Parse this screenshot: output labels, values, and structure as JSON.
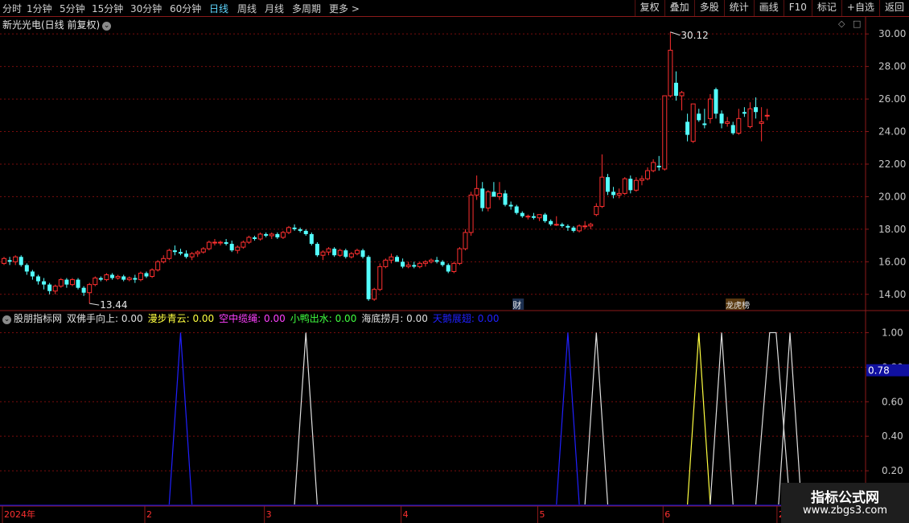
{
  "toolbar": {
    "periods": [
      "分时",
      "1分钟",
      "5分钟",
      "15分钟",
      "30分钟",
      "60分钟",
      "日线",
      "周线",
      "月线",
      "多周期",
      "更多 >"
    ],
    "active_period": "日线",
    "buttons": [
      "复权",
      "叠加",
      "多股",
      "统计",
      "画线",
      "F10",
      "标记",
      "+自选",
      "返回"
    ]
  },
  "stock": {
    "title": "新光光电(日线 前复权)"
  },
  "indicator": {
    "name": "股朋指标网",
    "items": [
      {
        "label": "双佛手向上: 0.00",
        "color": "#e0e0e0"
      },
      {
        "label": "漫步青云: 0.00",
        "color": "#ffff40"
      },
      {
        "label": "空中缆绳: 0.00",
        "color": "#ff40ff"
      },
      {
        "label": "小鸭出水: 0.00",
        "color": "#40ff40"
      },
      {
        "label": "海底捞月: 0.00",
        "color": "#e0e0e0"
      },
      {
        "label": "天鹅展翅: 0.00",
        "color": "#2020ff"
      }
    ],
    "cursor_value": "0.78"
  },
  "colors": {
    "up": "#ff3030",
    "down": "#54ffff",
    "grid": "#7a0d0d",
    "border": "#8b1a1a",
    "axis_text": "#c8c8c8"
  },
  "chart_data": [
    {
      "type": "candlestick",
      "ylim": [
        13.0,
        30.8
      ],
      "ylabel_ticks": [
        "30.00",
        "28.00",
        "26.00",
        "24.00",
        "22.00",
        "20.00",
        "18.00",
        "16.00",
        "14.00"
      ],
      "high_label": "30.12",
      "low_label": "13.44",
      "markers": [
        "财",
        "龙虎榜"
      ],
      "ohlc": [
        [
          15.9,
          16.3,
          15.8,
          16.2
        ],
        [
          16.1,
          16.3,
          15.8,
          16.0
        ],
        [
          16.0,
          16.4,
          15.8,
          16.3
        ],
        [
          16.3,
          16.4,
          15.7,
          15.8
        ],
        [
          15.8,
          15.9,
          15.2,
          15.4
        ],
        [
          15.4,
          15.5,
          14.9,
          15.1
        ],
        [
          15.1,
          15.2,
          14.6,
          14.8
        ],
        [
          14.8,
          15.0,
          14.3,
          14.6
        ],
        [
          14.6,
          14.7,
          14.0,
          14.2
        ],
        [
          14.2,
          14.6,
          14.0,
          14.5
        ],
        [
          14.5,
          15.0,
          14.4,
          14.9
        ],
        [
          14.9,
          15.0,
          14.4,
          14.6
        ],
        [
          14.6,
          15.0,
          14.5,
          14.9
        ],
        [
          14.9,
          15.0,
          14.3,
          14.4
        ],
        [
          14.4,
          14.5,
          13.9,
          14.1
        ],
        [
          14.1,
          14.7,
          13.44,
          14.6
        ],
        [
          14.6,
          15.1,
          14.5,
          15.0
        ],
        [
          15.0,
          15.1,
          14.8,
          14.9
        ],
        [
          14.9,
          15.3,
          14.8,
          15.2
        ],
        [
          15.2,
          15.3,
          14.9,
          15.0
        ],
        [
          15.0,
          15.2,
          14.9,
          15.1
        ],
        [
          15.1,
          15.2,
          14.8,
          14.9
        ],
        [
          14.9,
          15.1,
          14.8,
          15.0
        ],
        [
          15.0,
          15.2,
          14.7,
          14.9
        ],
        [
          14.9,
          15.4,
          14.8,
          15.3
        ],
        [
          15.3,
          15.4,
          15.0,
          15.1
        ],
        [
          15.1,
          15.6,
          15.0,
          15.5
        ],
        [
          15.5,
          16.1,
          15.4,
          16.0
        ],
        [
          16.0,
          16.4,
          15.9,
          16.2
        ],
        [
          16.2,
          16.8,
          16.1,
          16.7
        ],
        [
          16.7,
          17.0,
          16.4,
          16.6
        ],
        [
          16.6,
          16.8,
          16.4,
          16.5
        ],
        [
          16.5,
          16.7,
          16.2,
          16.3
        ],
        [
          16.3,
          16.6,
          16.1,
          16.5
        ],
        [
          16.5,
          16.7,
          16.3,
          16.6
        ],
        [
          16.6,
          16.9,
          16.5,
          16.8
        ],
        [
          16.8,
          17.3,
          16.7,
          17.2
        ],
        [
          17.2,
          17.4,
          17.0,
          17.2
        ],
        [
          17.2,
          17.3,
          17.0,
          17.2
        ],
        [
          17.2,
          17.4,
          17.0,
          17.1
        ],
        [
          17.1,
          17.3,
          16.6,
          16.7
        ],
        [
          16.7,
          17.0,
          16.5,
          16.9
        ],
        [
          16.9,
          17.3,
          16.8,
          17.2
        ],
        [
          17.2,
          17.6,
          17.1,
          17.5
        ],
        [
          17.5,
          17.6,
          17.3,
          17.4
        ],
        [
          17.4,
          17.8,
          17.3,
          17.7
        ],
        [
          17.7,
          17.8,
          17.5,
          17.6
        ],
        [
          17.6,
          17.8,
          17.4,
          17.7
        ],
        [
          17.7,
          17.8,
          17.4,
          17.5
        ],
        [
          17.5,
          17.9,
          17.4,
          17.8
        ],
        [
          17.8,
          18.2,
          17.7,
          18.1
        ],
        [
          18.1,
          18.3,
          17.9,
          18.0
        ],
        [
          18.0,
          18.1,
          17.8,
          17.9
        ],
        [
          17.9,
          18.0,
          17.6,
          17.7
        ],
        [
          17.7,
          17.8,
          17.0,
          17.1
        ],
        [
          17.1,
          17.2,
          16.3,
          16.4
        ],
        [
          16.4,
          16.7,
          16.1,
          16.6
        ],
        [
          16.6,
          16.9,
          16.4,
          16.8
        ],
        [
          16.8,
          16.9,
          16.3,
          16.4
        ],
        [
          16.4,
          16.8,
          16.3,
          16.7
        ],
        [
          16.7,
          16.8,
          16.2,
          16.3
        ],
        [
          16.3,
          16.6,
          16.2,
          16.5
        ],
        [
          16.5,
          16.8,
          16.4,
          16.7
        ],
        [
          16.7,
          16.8,
          16.2,
          16.3
        ],
        [
          16.3,
          16.4,
          13.6,
          13.7
        ],
        [
          13.7,
          14.4,
          13.6,
          14.3
        ],
        [
          14.3,
          15.9,
          14.2,
          15.7
        ],
        [
          15.7,
          16.2,
          15.6,
          16.1
        ],
        [
          16.1,
          16.5,
          15.9,
          16.3
        ],
        [
          16.3,
          16.4,
          16.0,
          16.0
        ],
        [
          16.0,
          16.2,
          15.6,
          15.7
        ],
        [
          15.7,
          16.0,
          15.6,
          15.8
        ],
        [
          15.8,
          16.0,
          15.6,
          15.7
        ],
        [
          15.7,
          16.0,
          15.6,
          15.9
        ],
        [
          15.9,
          16.1,
          15.7,
          16.0
        ],
        [
          16.0,
          16.2,
          15.9,
          16.1
        ],
        [
          16.1,
          16.3,
          15.9,
          16.0
        ],
        [
          16.0,
          16.1,
          15.7,
          15.8
        ],
        [
          15.8,
          15.9,
          15.3,
          15.4
        ],
        [
          15.4,
          16.0,
          15.3,
          15.9
        ],
        [
          15.9,
          16.9,
          15.8,
          16.8
        ],
        [
          16.8,
          18.0,
          16.7,
          17.8
        ],
        [
          17.8,
          20.3,
          17.6,
          20.1
        ],
        [
          20.1,
          21.3,
          19.8,
          20.5
        ],
        [
          20.5,
          20.9,
          19.1,
          19.3
        ],
        [
          19.3,
          20.4,
          19.1,
          20.3
        ],
        [
          20.3,
          20.9,
          20.0,
          20.0
        ],
        [
          20.0,
          20.9,
          19.8,
          20.2
        ],
        [
          20.2,
          20.4,
          19.4,
          19.5
        ],
        [
          19.5,
          19.7,
          19.2,
          19.4
        ],
        [
          19.4,
          19.5,
          18.9,
          19.0
        ],
        [
          19.0,
          19.1,
          18.7,
          18.8
        ],
        [
          18.8,
          18.9,
          18.6,
          18.8
        ],
        [
          18.8,
          19.0,
          18.6,
          18.7
        ],
        [
          18.7,
          18.9,
          18.5,
          18.9
        ],
        [
          18.9,
          19.0,
          18.4,
          18.5
        ],
        [
          18.5,
          18.6,
          18.2,
          18.3
        ],
        [
          18.3,
          18.8,
          18.2,
          18.3
        ],
        [
          18.3,
          18.4,
          18.1,
          18.2
        ],
        [
          18.2,
          18.3,
          17.9,
          18.1
        ],
        [
          18.1,
          18.2,
          17.8,
          17.9
        ],
        [
          17.9,
          18.3,
          17.8,
          18.2
        ],
        [
          18.2,
          18.5,
          18.0,
          18.2
        ],
        [
          18.2,
          18.4,
          18.0,
          18.3
        ],
        [
          18.9,
          19.6,
          18.8,
          19.4
        ],
        [
          19.4,
          22.6,
          19.3,
          21.2
        ],
        [
          21.2,
          21.4,
          20.1,
          20.3
        ],
        [
          20.3,
          20.6,
          19.9,
          20.1
        ],
        [
          20.1,
          20.5,
          19.9,
          20.2
        ],
        [
          20.2,
          21.2,
          20.1,
          21.1
        ],
        [
          21.1,
          21.3,
          20.2,
          20.4
        ],
        [
          20.4,
          21.2,
          20.3,
          21.0
        ],
        [
          21.0,
          21.3,
          20.7,
          21.1
        ],
        [
          21.1,
          21.8,
          21.0,
          21.6
        ],
        [
          21.6,
          22.3,
          21.5,
          22.1
        ],
        [
          21.9,
          22.5,
          21.6,
          21.8
        ],
        [
          21.7,
          26.2,
          21.6,
          26.2
        ],
        [
          26.2,
          30.12,
          26.1,
          29.0
        ],
        [
          27.0,
          27.7,
          25.9,
          26.2
        ],
        [
          26.2,
          26.5,
          25.3,
          26.4
        ],
        [
          24.6,
          25.1,
          23.4,
          23.8
        ],
        [
          23.4,
          25.6,
          23.3,
          25.7
        ],
        [
          25.1,
          25.4,
          24.6,
          24.7
        ],
        [
          24.5,
          25.4,
          24.2,
          24.4
        ],
        [
          24.8,
          26.3,
          24.5,
          26.0
        ],
        [
          26.6,
          26.7,
          24.8,
          25.1
        ],
        [
          25.1,
          25.3,
          24.2,
          24.5
        ],
        [
          24.5,
          24.9,
          24.3,
          24.6
        ],
        [
          24.4,
          24.6,
          23.8,
          23.9
        ],
        [
          23.9,
          25.4,
          23.8,
          24.8
        ],
        [
          25.2,
          25.5,
          24.9,
          25.1
        ],
        [
          24.3,
          25.8,
          24.2,
          25.4
        ],
        [
          25.5,
          26.1,
          24.8,
          25.2
        ],
        [
          24.5,
          25.5,
          23.4,
          24.6
        ],
        [
          25.0,
          25.4,
          24.7,
          25.0
        ]
      ]
    },
    {
      "type": "line",
      "ylim": [
        0,
        1.1
      ],
      "ylabel_ticks": [
        "1.00",
        "0.80",
        "0.60",
        "0.40",
        "0.20"
      ],
      "x_labels": [
        "2024年",
        "2",
        "3",
        "4",
        "5",
        "6",
        "20"
      ],
      "series": [
        {
          "name": "双佛手向上",
          "color": "#e0e0e0",
          "values": []
        },
        {
          "name": "漫步青云",
          "color": "#ffff40",
          "values": []
        },
        {
          "name": "空中缆绳",
          "color": "#ff40ff",
          "values": []
        },
        {
          "name": "小鸭出水",
          "color": "#40ff40",
          "values": []
        },
        {
          "name": "海底捞月",
          "color": "#e0e0e0",
          "values": []
        },
        {
          "name": "天鹅展翅",
          "color": "#2020ff",
          "values": []
        }
      ],
      "spikes": [
        {
          "series": "天鹅展翅",
          "center_day": 31,
          "width": 2
        },
        {
          "series": "海底捞月",
          "center_day": 53,
          "width": 2
        },
        {
          "series": "天鹅展翅",
          "center_day": 99,
          "width": 2
        },
        {
          "series": "海底捞月",
          "center_day": 104,
          "width": 2
        },
        {
          "series": "漫步青云",
          "center_day": 122,
          "width": 2
        },
        {
          "series": "海底捞月",
          "center_day": 126,
          "width": 2
        },
        {
          "series": "海底捞月",
          "center_day": 135,
          "width": 3
        },
        {
          "series": "海底捞月",
          "center_day": 138,
          "width": 2
        }
      ]
    }
  ],
  "watermark": {
    "line1": "指标公式网",
    "line2": "www.zbgs3.com"
  }
}
